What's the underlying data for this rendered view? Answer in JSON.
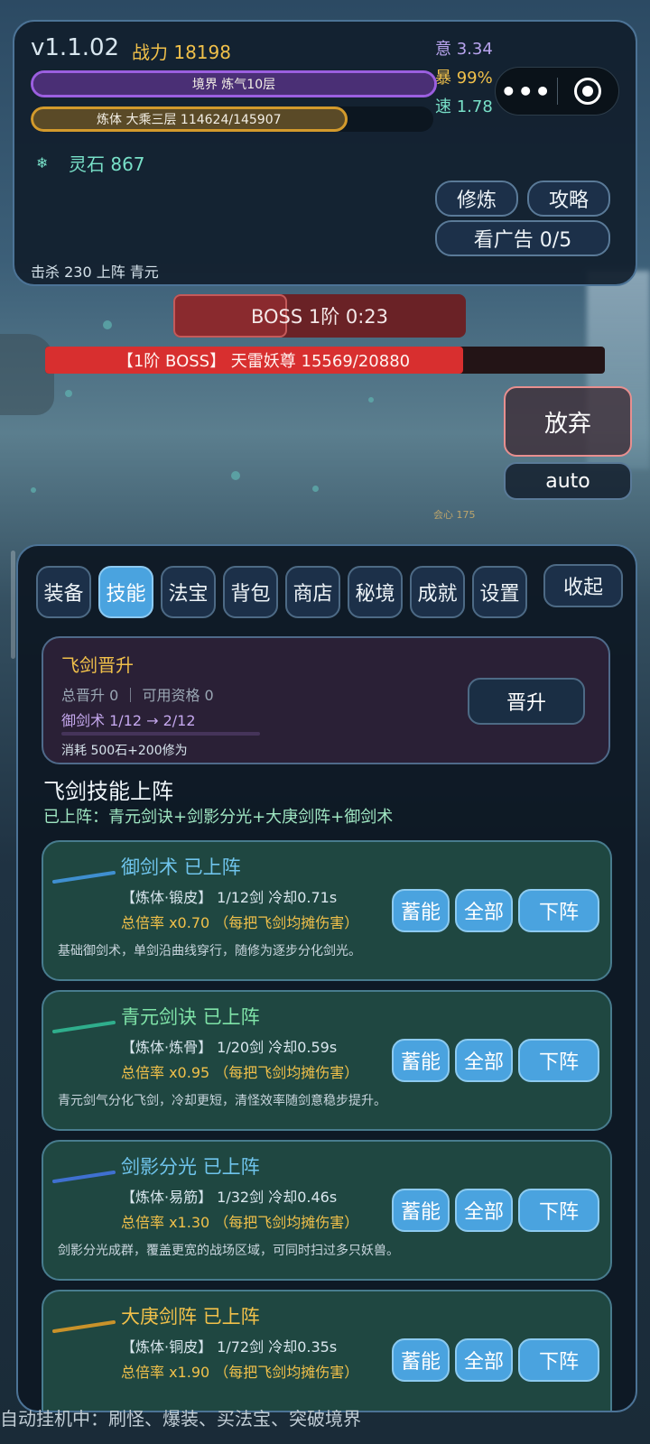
{
  "hud": {
    "version": "v1.1.02",
    "power": "战力 18198",
    "stat_yi": "意 3.34",
    "stat_bao": "暴 99%",
    "stat_su": "速 1.78",
    "realm_bar": {
      "label": "境界 炼气10层",
      "progress": 1.0
    },
    "body_bar": {
      "label": "炼体 大乘三层 114624/145907",
      "progress": 0.786
    },
    "stones": "灵石 867",
    "btn_train": "修炼",
    "btn_guide": "攻略",
    "btn_ad": "看广告 0/5",
    "kills": "击杀 230  上阵 青元",
    "menu_dots": "•••"
  },
  "boss": {
    "timer": "BOSS 1阶   0:23",
    "timer_progress": 0.39,
    "hp_label": "【1阶 BOSS】 天雷妖尊  15569/20880",
    "hp_progress": 0.746,
    "btn_giveup": "放弃",
    "btn_auto": "auto",
    "crit_text": "会心 175"
  },
  "tabs": [
    {
      "label": "装备",
      "active": false
    },
    {
      "label": "技能",
      "active": true
    },
    {
      "label": "法宝",
      "active": false
    },
    {
      "label": "背包",
      "active": false
    },
    {
      "label": "商店",
      "active": false
    },
    {
      "label": "秘境",
      "active": false
    },
    {
      "label": "成就",
      "active": false
    },
    {
      "label": "设置",
      "active": false
    }
  ],
  "collapse_label": "收起",
  "ascend": {
    "title": "飞剑晋升",
    "line1": "总晋升 0 ｜ 可用资格 0",
    "line2": "御剑术  1/12 → 2/12",
    "cost": "消耗 500石+200修为",
    "button": "晋升"
  },
  "section": {
    "title": "飞剑技能上阵",
    "equipped": "已上阵：青元剑诀+剑影分光+大庚剑阵+御剑术"
  },
  "skills": [
    {
      "name": "御剑术  已上阵",
      "name_color": "#6fc4ec",
      "sword_color": "#3f8fd0",
      "meta": "【炼体·锻皮】 1/12剑  冷却0.71s",
      "rate": "总倍率 x0.70  （每把飞剑均摊伤害）",
      "desc": "基础御剑术，单剑沿曲线穿行，随修为逐步分化剑光。",
      "b1": "蓄能",
      "b2": "全部",
      "b3": "下阵"
    },
    {
      "name": "青元剑诀  已上阵",
      "name_color": "#7fe3a8",
      "sword_color": "#2fae8c",
      "meta": "【炼体·炼骨】 1/20剑  冷却0.59s",
      "rate": "总倍率 x0.95  （每把飞剑均摊伤害）",
      "desc": "青元剑气分化飞剑，冷却更短，清怪效率随剑意稳步提升。",
      "b1": "蓄能",
      "b2": "全部",
      "b3": "下阵"
    },
    {
      "name": "剑影分光  已上阵",
      "name_color": "#6fc4ec",
      "sword_color": "#3f70d0",
      "meta": "【炼体·易筋】 1/32剑  冷却0.46s",
      "rate": "总倍率 x1.30  （每把飞剑均摊伤害）",
      "desc": "剑影分光成群，覆盖更宽的战场区域，可同时扫过多只妖兽。",
      "b1": "蓄能",
      "b2": "全部",
      "b3": "下阵"
    },
    {
      "name": "大庚剑阵  已上阵",
      "name_color": "#f0c04a",
      "sword_color": "#c9922a",
      "meta": "【炼体·铜皮】 1/72剑  冷却0.35s",
      "rate": "总倍率 x1.90  （每把飞剑均摊伤害）",
      "desc": "",
      "b1": "蓄能",
      "b2": "全部",
      "b3": "下阵"
    }
  ],
  "footer": "自动挂机中：刷怪、爆装、买法宝、突破境界"
}
